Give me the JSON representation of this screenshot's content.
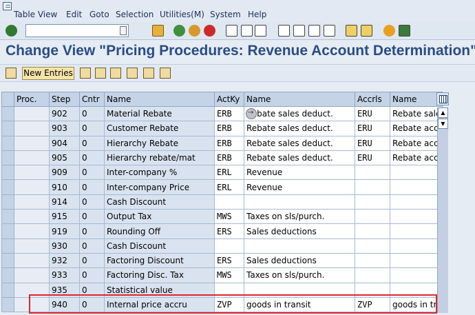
{
  "menu": [
    "Table View",
    "Edit",
    "Goto",
    "Selection",
    "Utilities(M)",
    "System",
    "Help"
  ],
  "title": "Change View \"Pricing Procedures: Revenue Account Determination\":",
  "app_toolbar": {
    "new_entries": "New Entries"
  },
  "table": {
    "headers": [
      "Proc.",
      "Step",
      "Cntr",
      "Name",
      "ActKy",
      "Name",
      "Accrls",
      "Name"
    ],
    "rows": [
      {
        "proc": "",
        "step": "902",
        "cntr": "0",
        "name": "Material Rebate",
        "actky": "ERB",
        "acname": "Rebate sales deduct.",
        "accrls": "ERU",
        "accname": "Rebate sale"
      },
      {
        "proc": "",
        "step": "903",
        "cntr": "0",
        "name": "Customer Rebate",
        "actky": "ERB",
        "acname": "Rebate sales deduct.",
        "accrls": "ERU",
        "accname": "Rebate accr"
      },
      {
        "proc": "",
        "step": "904",
        "cntr": "0",
        "name": "Hierarchy Rebate",
        "actky": "ERB",
        "acname": "Rebate sales deduct.",
        "accrls": "ERU",
        "accname": "Rebate accr"
      },
      {
        "proc": "",
        "step": "905",
        "cntr": "0",
        "name": "Hierarchy rebate/mat",
        "actky": "ERB",
        "acname": "Rebate sales deduct.",
        "accrls": "ERU",
        "accname": "Rebate accr"
      },
      {
        "proc": "",
        "step": "909",
        "cntr": "0",
        "name": "Inter-company %",
        "actky": "ERL",
        "acname": "Revenue",
        "accrls": "",
        "accname": ""
      },
      {
        "proc": "",
        "step": "910",
        "cntr": "0",
        "name": "Inter-company Price",
        "actky": "ERL",
        "acname": "Revenue",
        "accrls": "",
        "accname": ""
      },
      {
        "proc": "",
        "step": "914",
        "cntr": "0",
        "name": "Cash Discount",
        "actky": "",
        "acname": "",
        "accrls": "",
        "accname": ""
      },
      {
        "proc": "",
        "step": "915",
        "cntr": "0",
        "name": "Output Tax",
        "actky": "MWS",
        "acname": "Taxes on sls/purch.",
        "accrls": "",
        "accname": ""
      },
      {
        "proc": "",
        "step": "919",
        "cntr": "0",
        "name": "Rounding Off",
        "actky": "ERS",
        "acname": "Sales deductions",
        "accrls": "",
        "accname": ""
      },
      {
        "proc": "",
        "step": "930",
        "cntr": "0",
        "name": "Cash Discount",
        "actky": "",
        "acname": "",
        "accrls": "",
        "accname": ""
      },
      {
        "proc": "",
        "step": "932",
        "cntr": "0",
        "name": "Factoring Discount",
        "actky": "ERS",
        "acname": "Sales deductions",
        "accrls": "",
        "accname": ""
      },
      {
        "proc": "",
        "step": "933",
        "cntr": "0",
        "name": "Factoring Disc. Tax",
        "actky": "MWS",
        "acname": "Taxes on sls/purch.",
        "accrls": "",
        "accname": ""
      },
      {
        "proc": "",
        "step": "935",
        "cntr": "0",
        "name": "Statistical value",
        "actky": "",
        "acname": "",
        "accrls": "",
        "accname": ""
      },
      {
        "proc": "",
        "step": "940",
        "cntr": "0",
        "name": "Internal price accru",
        "actky": "ZVP",
        "acname": "goods in transit",
        "accrls": "ZVP",
        "accname": "goods in tra"
      }
    ]
  },
  "icons": {
    "check": "check-icon",
    "save": "save-icon",
    "back": "back-icon",
    "exit": "exit-icon",
    "cancel": "cancel-icon",
    "print": "print-icon",
    "find": "find-icon",
    "help": "help-icon",
    "layout": "layout-icon"
  },
  "colors": {
    "title": "#2a4c84",
    "accent_button": "#f4e4a8",
    "highlight": "#e0252a"
  }
}
